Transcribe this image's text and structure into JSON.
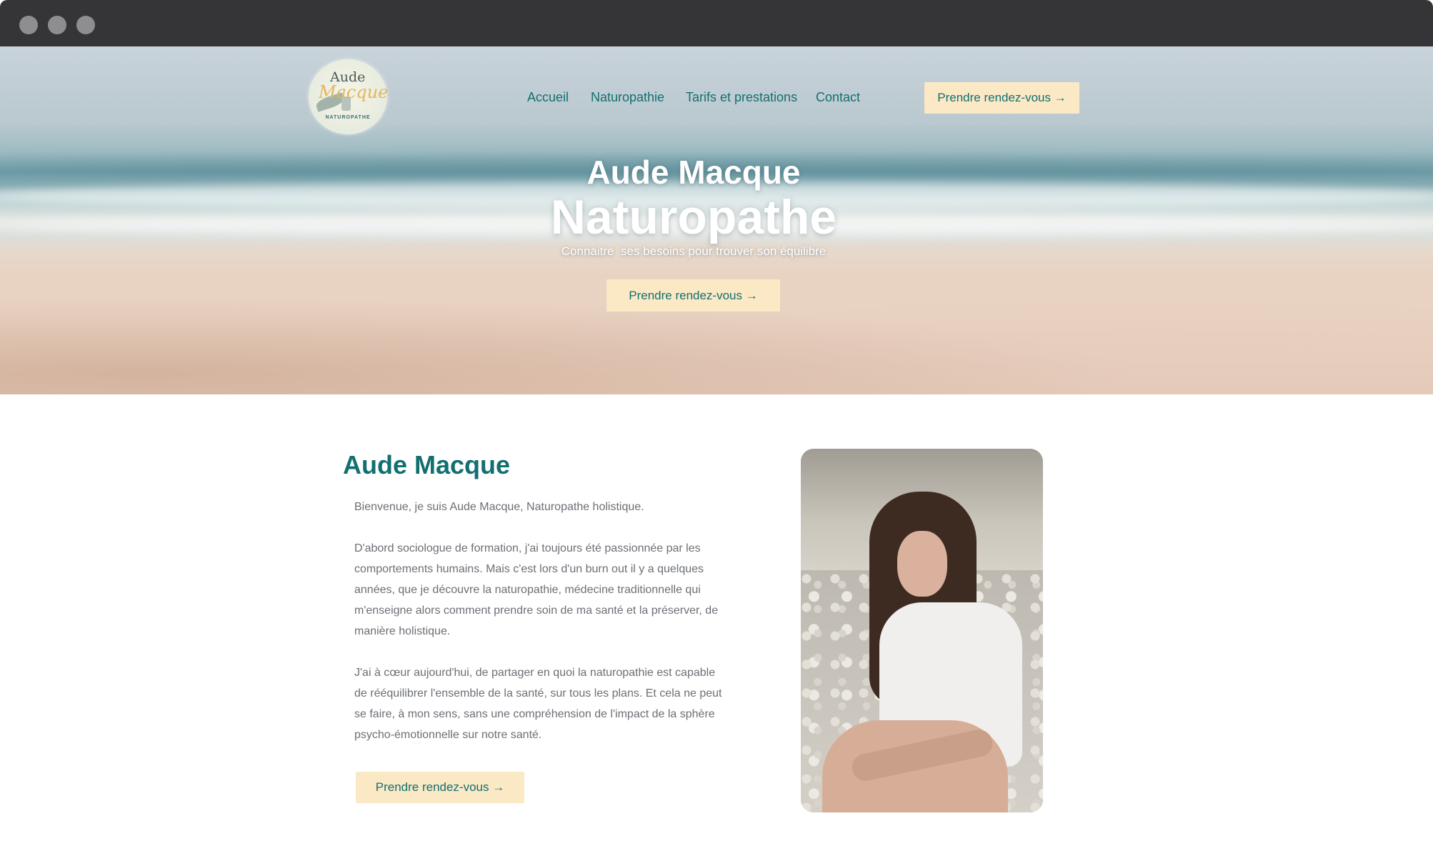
{
  "window": {
    "controls": [
      "close",
      "minimize",
      "maximize"
    ]
  },
  "brand": {
    "logo_line1": "Aude",
    "logo_line2": "Macque",
    "logo_line3": "NATUROPATHE"
  },
  "nav": {
    "items": [
      {
        "label": "Accueil"
      },
      {
        "label": "Naturopathie"
      },
      {
        "label": "Tarifs et prestations"
      },
      {
        "label": "Contact"
      }
    ],
    "cta_label": "Prendre rendez-vous →"
  },
  "hero": {
    "name": "Aude Macque",
    "title": "Naturopathe",
    "subtitle": "Connaitre  ses besoins pour trouver son équilibre",
    "cta_label": "Prendre rendez-vous →"
  },
  "about": {
    "heading": "Aude Macque",
    "paragraphs": [
      "Bienvenue, je suis Aude Macque, Naturopathe holistique.",
      "D'abord sociologue de formation, j'ai toujours été passionnée par les comportements humains. Mais c'est lors d'un burn out il y a quelques années, que je découvre la naturopathie, médecine traditionnelle qui m'enseigne alors comment prendre soin de ma santé et la préserver, de manière holistique.",
      "J'ai à cœur aujourd'hui, de partager en quoi la naturopathie est capable de rééquilibrer l'ensemble de la santé, sur tous les plans. Et cela ne peut se faire, à mon sens, sans une compréhension de l'impact de la sphère psycho-émotionnelle sur notre santé."
    ],
    "cta_label": "Prendre rendez-vous →"
  },
  "colors": {
    "accent": "#126f70",
    "button_bg": "#fbe9c6",
    "chrome": "#353537",
    "body_text": "#6b6f75"
  }
}
